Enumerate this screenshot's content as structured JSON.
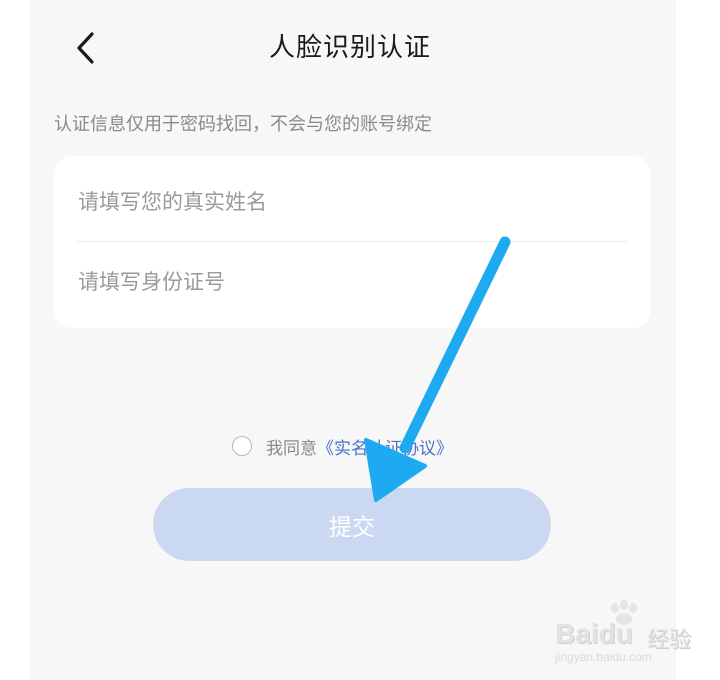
{
  "header": {
    "title": "人脸识别认证",
    "back_icon": "chevron-left-icon"
  },
  "notice": "认证信息仅用于密码找回，不会与您的账号绑定",
  "form": {
    "name_placeholder": "请填写您的真实姓名",
    "name_value": "",
    "id_placeholder": "请填写身份证号",
    "id_value": ""
  },
  "agreement": {
    "checked": false,
    "prefix": "我同意",
    "link": "《实名认证协议》"
  },
  "submit": {
    "label": "提交",
    "enabled": false
  },
  "watermark": {
    "brand": "Bai",
    "brand_suffix": "du",
    "brand_cn": "经验",
    "url": "jingyan.baidu.com"
  },
  "colors": {
    "background": "#f7f7f7",
    "card": "#ffffff",
    "link": "#4a72c8",
    "submit_disabled": "#cbd8f1",
    "annotation_arrow": "#1eaaf1"
  }
}
